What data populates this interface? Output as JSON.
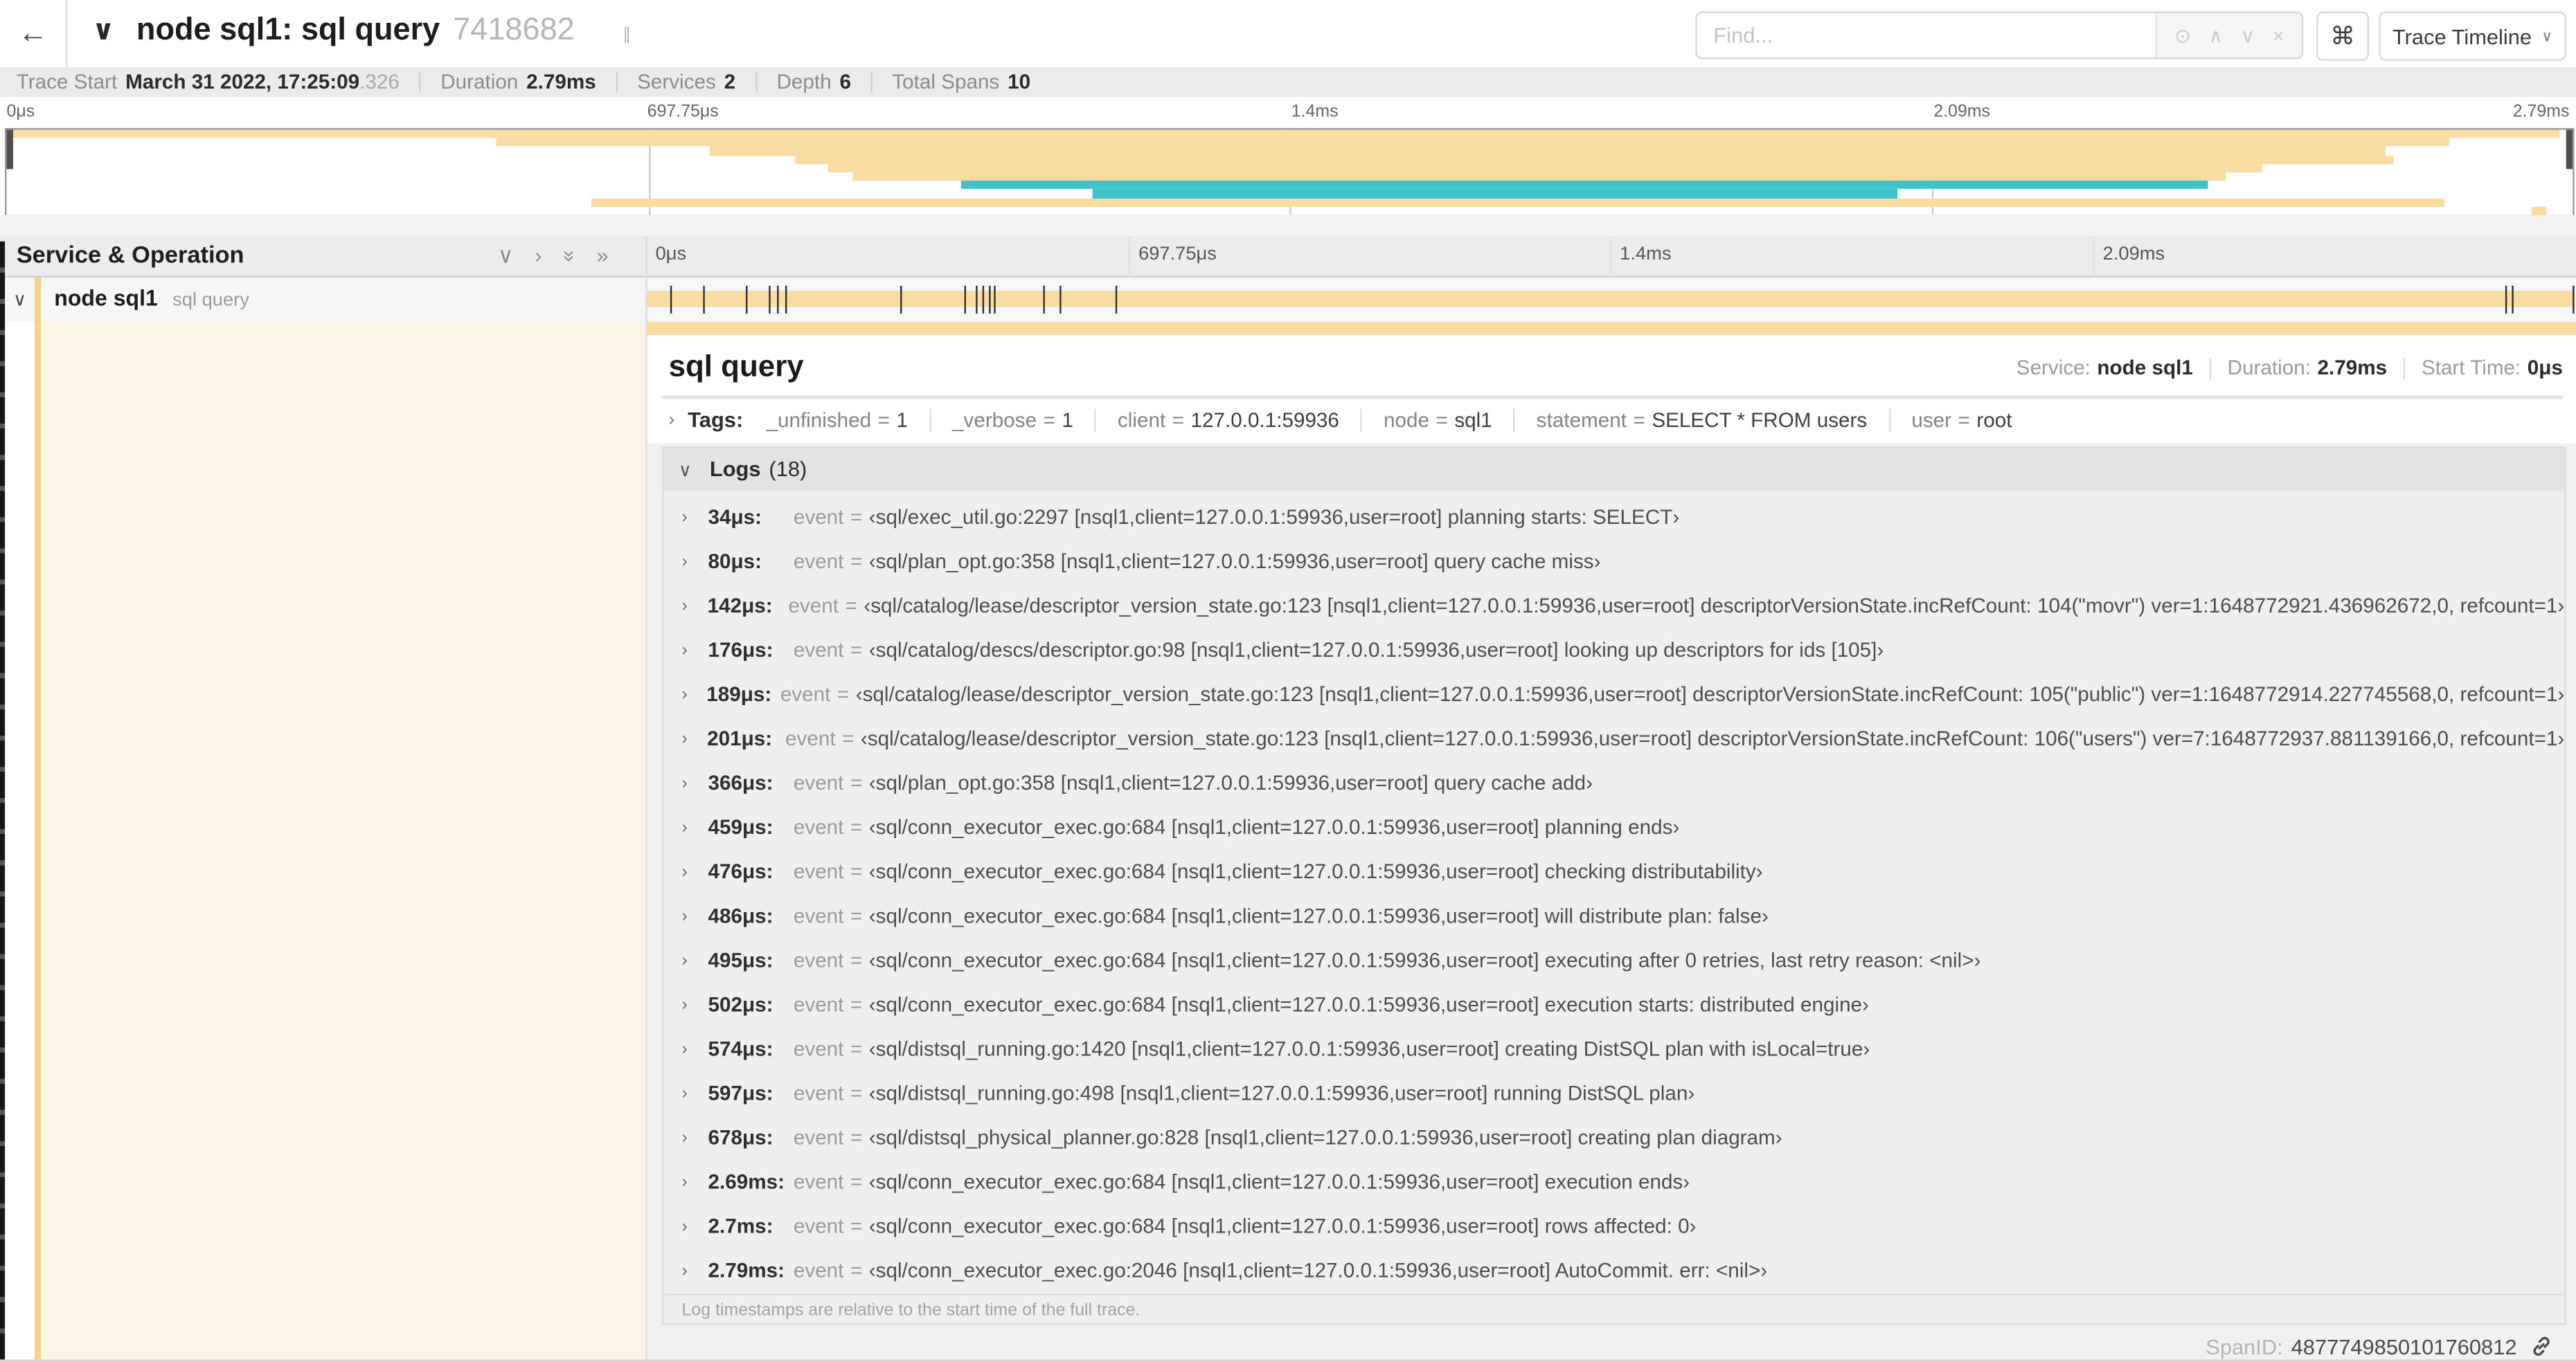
{
  "header": {
    "back_icon": "←",
    "collapse_chevron": "∨",
    "title": "node sql1: sql query",
    "trace_id": "7418682",
    "find_placeholder": "Find...",
    "find_icons": {
      "target": "⊙",
      "prev": "∧",
      "next": "∨",
      "clear": "×"
    },
    "shortcuts_button": "⌘",
    "view_button": "Trace Timeline",
    "view_caret": "∨"
  },
  "trace_info": [
    {
      "label": "Trace Start",
      "value": "March 31 2022, 17:25:09",
      "frac": ".326"
    },
    {
      "label": "Duration",
      "value": "2.79ms",
      "frac": ""
    },
    {
      "label": "Services",
      "value": "2",
      "frac": ""
    },
    {
      "label": "Depth",
      "value": "6",
      "frac": ""
    },
    {
      "label": "Total Spans",
      "value": "10",
      "frac": ""
    }
  ],
  "axis_labels": [
    "0μs",
    "697.75μs",
    "1.4ms",
    "2.09ms",
    "2.79ms"
  ],
  "minimap": {
    "colors": {
      "tan": "#F8DCA1",
      "teal": "#3EC3C6"
    },
    "spans": [
      {
        "start": 0.0,
        "end": 99.5,
        "color": "tan"
      },
      {
        "start": 19.1,
        "end": 95.2,
        "color": "tan"
      },
      {
        "start": 27.4,
        "end": 92.7,
        "color": "tan"
      },
      {
        "start": 30.7,
        "end": 93.0,
        "color": "tan"
      },
      {
        "start": 32.0,
        "end": 87.9,
        "color": "tan"
      },
      {
        "start": 33.0,
        "end": 86.5,
        "color": "tan"
      },
      {
        "start": 37.2,
        "end": 85.8,
        "color": "teal"
      },
      {
        "start": 42.3,
        "end": 73.7,
        "color": "teal"
      },
      {
        "start": 22.8,
        "end": 95.0,
        "color": "tan"
      },
      {
        "start": 98.4,
        "end": 99.0,
        "color": "tan"
      }
    ]
  },
  "span_table": {
    "header": "Service & Operation",
    "header_icons": {
      "collapse_all": "∨",
      "collapse_one": "›",
      "expand_all": "»",
      "expand_one": "»",
      "grip": "∥"
    },
    "row": {
      "chevron": "∨",
      "service": "node sql1",
      "operation": "sql query"
    },
    "tick_percents": [
      1.22,
      2.87,
      5.09,
      6.31,
      6.77,
      7.2,
      13.12,
      16.45,
      17.06,
      17.42,
      17.74,
      17.99,
      20.57,
      21.4,
      24.3,
      96.42,
      96.77,
      99.9
    ]
  },
  "detail": {
    "title": "sql query",
    "meta": [
      {
        "label": "Service:",
        "value": "node sql1"
      },
      {
        "label": "Duration:",
        "value": "2.79ms"
      },
      {
        "label": "Start Time:",
        "value": "0μs"
      }
    ],
    "tags_arrow": "›",
    "tags_label": "Tags:",
    "tags": [
      {
        "key": "_unfinished",
        "value": "1"
      },
      {
        "key": "_verbose",
        "value": "1"
      },
      {
        "key": "client",
        "value": "127.0.0.1:59936"
      },
      {
        "key": "node",
        "value": "sql1"
      },
      {
        "key": "statement",
        "value": "SELECT * FROM users"
      },
      {
        "key": "user",
        "value": "root"
      }
    ],
    "logs_chevron": "∨",
    "logs_label": "Logs",
    "logs_count": "(18)",
    "log_key": "event",
    "logs": [
      {
        "time": "34μs:",
        "value": "‹sql/exec_util.go:2297 [nsql1,client=127.0.0.1:59936,user=root] planning starts: SELECT›"
      },
      {
        "time": "80μs:",
        "value": "‹sql/plan_opt.go:358 [nsql1,client=127.0.0.1:59936,user=root] query cache miss›"
      },
      {
        "time": "142μs:",
        "value": "‹sql/catalog/lease/descriptor_version_state.go:123 [nsql1,client=127.0.0.1:59936,user=root] descriptorVersionState.incRefCount: 104(\"movr\") ver=1:1648772921.436962672,0, refcount=1›"
      },
      {
        "time": "176μs:",
        "value": "‹sql/catalog/descs/descriptor.go:98 [nsql1,client=127.0.0.1:59936,user=root] looking up descriptors for ids [105]›"
      },
      {
        "time": "189μs:",
        "value": "‹sql/catalog/lease/descriptor_version_state.go:123 [nsql1,client=127.0.0.1:59936,user=root] descriptorVersionState.incRefCount: 105(\"public\") ver=1:1648772914.227745568,0, refcount=1›"
      },
      {
        "time": "201μs:",
        "value": "‹sql/catalog/lease/descriptor_version_state.go:123 [nsql1,client=127.0.0.1:59936,user=root] descriptorVersionState.incRefCount: 106(\"users\") ver=7:1648772937.881139166,0, refcount=1›"
      },
      {
        "time": "366μs:",
        "value": "‹sql/plan_opt.go:358 [nsql1,client=127.0.0.1:59936,user=root] query cache add›"
      },
      {
        "time": "459μs:",
        "value": "‹sql/conn_executor_exec.go:684 [nsql1,client=127.0.0.1:59936,user=root] planning ends›"
      },
      {
        "time": "476μs:",
        "value": "‹sql/conn_executor_exec.go:684 [nsql1,client=127.0.0.1:59936,user=root] checking distributability›"
      },
      {
        "time": "486μs:",
        "value": "‹sql/conn_executor_exec.go:684 [nsql1,client=127.0.0.1:59936,user=root] will distribute plan: false›"
      },
      {
        "time": "495μs:",
        "value": "‹sql/conn_executor_exec.go:684 [nsql1,client=127.0.0.1:59936,user=root] executing after 0 retries, last retry reason: <nil>›"
      },
      {
        "time": "502μs:",
        "value": "‹sql/conn_executor_exec.go:684 [nsql1,client=127.0.0.1:59936,user=root] execution starts: distributed engine›"
      },
      {
        "time": "574μs:",
        "value": "‹sql/distsql_running.go:1420 [nsql1,client=127.0.0.1:59936,user=root] creating DistSQL plan with isLocal=true›"
      },
      {
        "time": "597μs:",
        "value": "‹sql/distsql_running.go:498 [nsql1,client=127.0.0.1:59936,user=root] running DistSQL plan›"
      },
      {
        "time": "678μs:",
        "value": "‹sql/distsql_physical_planner.go:828 [nsql1,client=127.0.0.1:59936,user=root] creating plan diagram›"
      },
      {
        "time": "2.69ms:",
        "value": "‹sql/conn_executor_exec.go:684 [nsql1,client=127.0.0.1:59936,user=root] execution ends›"
      },
      {
        "time": "2.7ms:",
        "value": "‹sql/conn_executor_exec.go:684 [nsql1,client=127.0.0.1:59936,user=root] rows affected: 0›"
      },
      {
        "time": "2.79ms:",
        "value": "‹sql/conn_executor_exec.go:2046 [nsql1,client=127.0.0.1:59936,user=root] AutoCommit. err: <nil>›"
      }
    ],
    "logs_footer": "Log timestamps are relative to the start time of the full trace.",
    "span_id_label": "SpanID:",
    "span_id": "4877749850101760812"
  }
}
